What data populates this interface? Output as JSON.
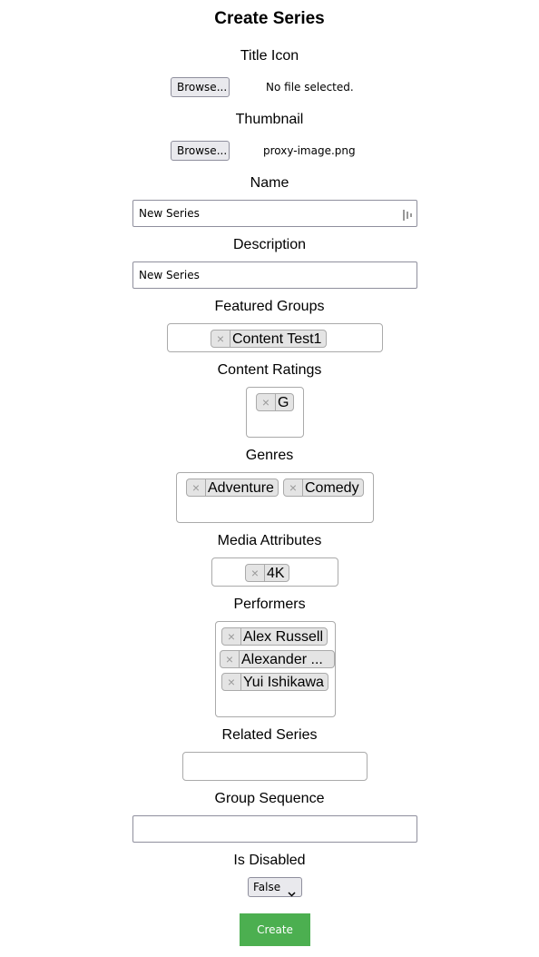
{
  "page": {
    "title": "Create Series"
  },
  "fields": {
    "title_icon": {
      "label": "Title Icon",
      "browse_label": "Browse...",
      "file_name": "No file selected."
    },
    "thumbnail": {
      "label": "Thumbnail",
      "browse_label": "Browse...",
      "file_name": "proxy-image.png"
    },
    "name": {
      "label": "Name",
      "value": "New Series"
    },
    "description": {
      "label": "Description",
      "value": "New Series"
    },
    "featured_groups": {
      "label": "Featured Groups",
      "tags": [
        "Content Test1"
      ]
    },
    "content_ratings": {
      "label": "Content Ratings",
      "tags": [
        "G"
      ]
    },
    "genres": {
      "label": "Genres",
      "tags": [
        "Adventure",
        "Comedy"
      ]
    },
    "media_attributes": {
      "label": "Media Attributes",
      "tags": [
        "4K"
      ]
    },
    "performers": {
      "label": "Performers",
      "tags": [
        "Alex Russell",
        "Alexander ...",
        "Yui Ishikawa"
      ]
    },
    "related_series": {
      "label": "Related Series",
      "value": ""
    },
    "group_sequence": {
      "label": "Group Sequence",
      "value": ""
    },
    "is_disabled": {
      "label": "Is Disabled",
      "selected": "False"
    }
  },
  "tag_remove_glyph": "×",
  "submit": {
    "label": "Create",
    "color": "#4caf50"
  }
}
